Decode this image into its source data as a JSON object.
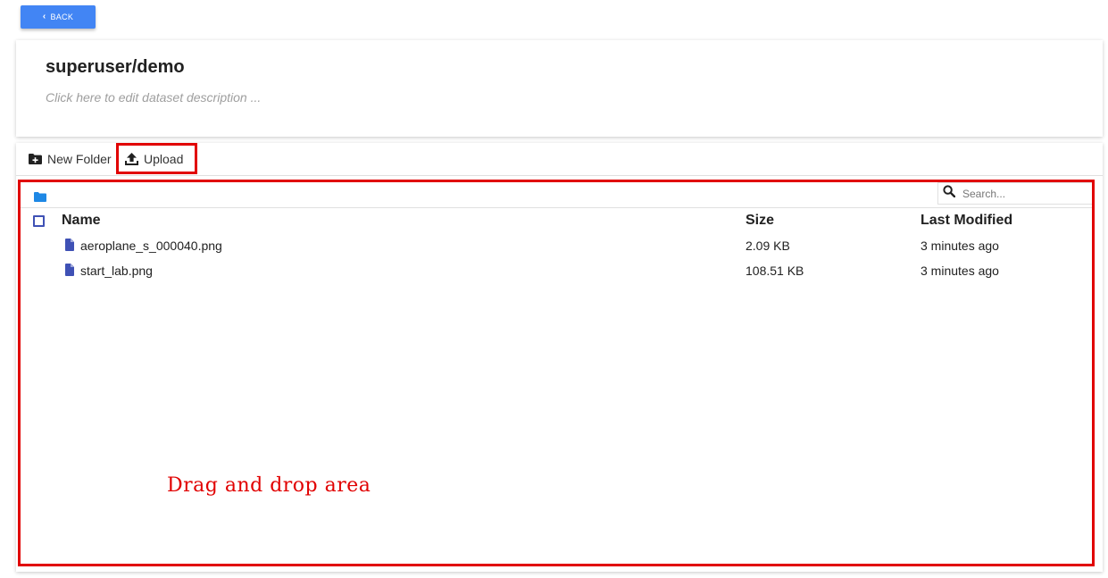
{
  "back_button": {
    "label": "BACK",
    "icon": "chevron-left-icon"
  },
  "header": {
    "title": "superuser/demo",
    "description_placeholder": "Click here to edit dataset description ..."
  },
  "toolbar": {
    "new_folder_label": "New Folder",
    "new_folder_icon": "folder-plus-icon",
    "upload_label": "Upload",
    "upload_icon": "upload-icon"
  },
  "search": {
    "placeholder": "Search...",
    "icon": "search-icon"
  },
  "table": {
    "columns": {
      "name": "Name",
      "size": "Size",
      "modified": "Last Modified"
    },
    "rows": [
      {
        "name": "aeroplane_s_000040.png",
        "size": "2.09 KB",
        "modified": "3 minutes ago",
        "icon": "file-icon"
      },
      {
        "name": "start_lab.png",
        "size": "108.51 KB",
        "modified": "3 minutes ago",
        "icon": "file-icon"
      }
    ]
  },
  "drop_area": {
    "label": "Drag and drop area"
  },
  "colors": {
    "primary": "#4285f4",
    "annotation_red": "#e10000",
    "file_icon": "#3f51b5",
    "folder_icon": "#1e88e5"
  }
}
